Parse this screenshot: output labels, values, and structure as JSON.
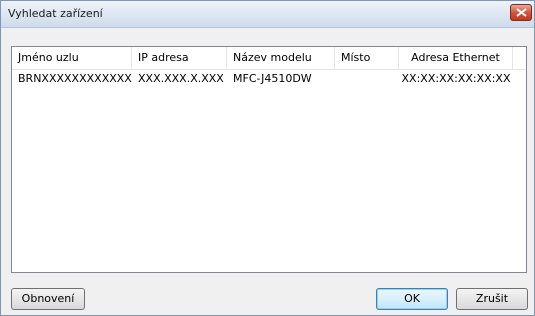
{
  "window": {
    "title": "Vyhledat zařízení"
  },
  "table": {
    "columns": [
      "Jméno uzlu",
      "IP adresa",
      "Název modelu",
      "Místo",
      "Adresa Ethernet"
    ],
    "rows": [
      {
        "node": "BRNXXXXXXXXXXXX",
        "ip": "XXX.XXX.X.XXX",
        "model": "MFC-J4510DW",
        "location": "",
        "mac": "XX:XX:XX:XX:XX:XX"
      }
    ]
  },
  "buttons": {
    "refresh": "Obnovení",
    "ok": "OK",
    "cancel": "Zrušit"
  },
  "colors": {
    "close_button": "#c7432b",
    "default_button_border": "#3c7fb1"
  }
}
